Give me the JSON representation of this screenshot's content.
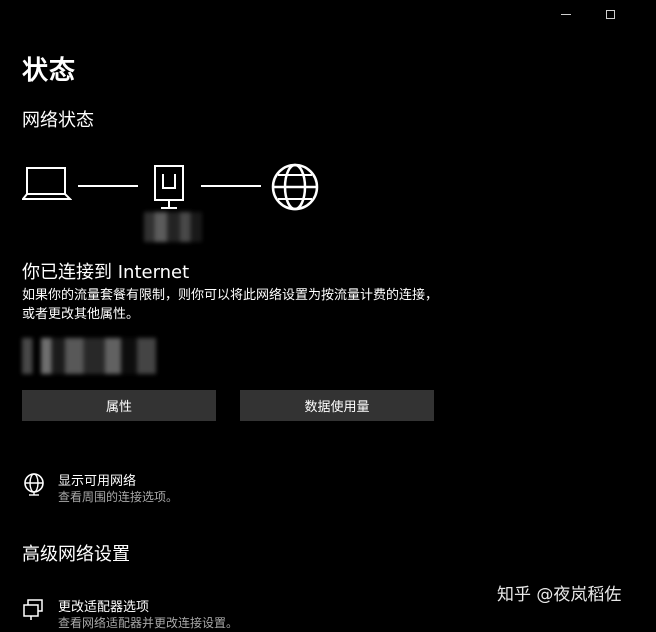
{
  "window": {
    "minimize_icon": "minimize-icon",
    "maximize_icon": "maximize-icon"
  },
  "header": {
    "title": "状态",
    "section": "网络状态"
  },
  "diagram": {
    "laptop_icon": "laptop-icon",
    "router_icon": "ethernet-adapter-icon",
    "globe_icon": "globe-icon"
  },
  "status": {
    "title": "你已连接到 Internet",
    "description": "如果你的流量套餐有限制，则你可以将此网络设置为按流量计费的连接，或者更改其他属性。"
  },
  "buttons": {
    "properties": "属性",
    "data_usage": "数据使用量"
  },
  "options": [
    {
      "label": "显示可用网络",
      "sub": "查看周围的连接选项。",
      "icon": "wifi-globe-icon"
    },
    {
      "label": "更改适配器选项",
      "sub": "查看网络适配器并更改连接设置。",
      "icon": "network-adapter-icon"
    }
  ],
  "advanced": {
    "title": "高级网络设置"
  },
  "watermark": "知乎 @夜岚稻佐"
}
